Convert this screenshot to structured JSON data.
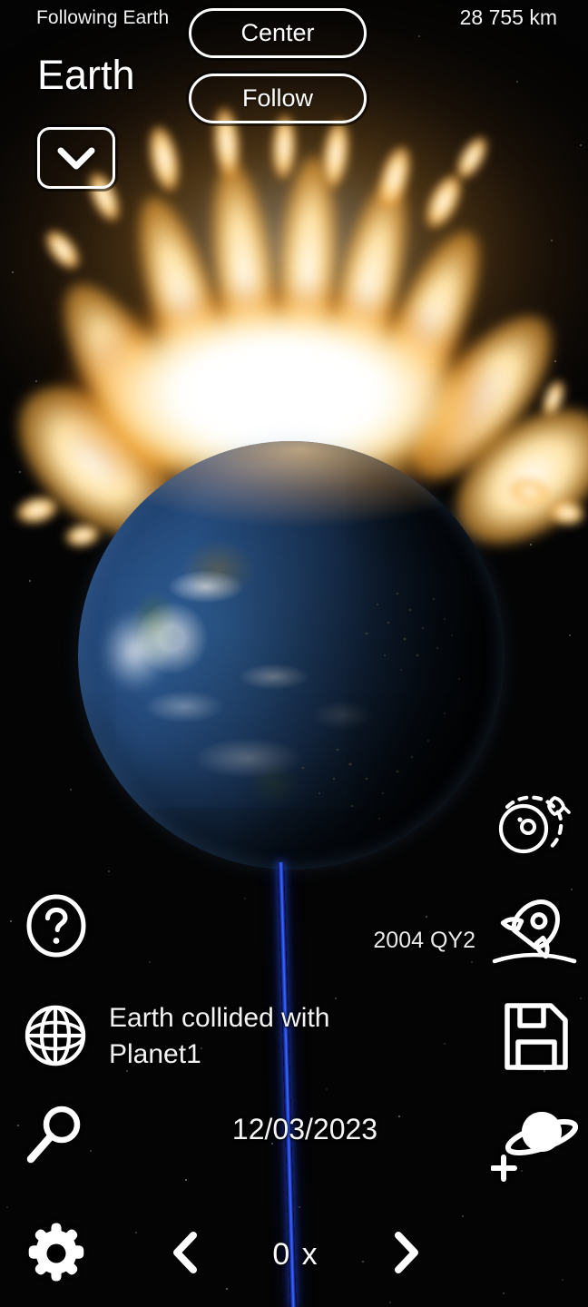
{
  "hud": {
    "following_label": "Following Earth",
    "distance": "28 755 km",
    "body_name": "Earth",
    "center_label": "Center",
    "follow_label": "Follow",
    "collapse_icon": "chevron-down-icon"
  },
  "sim": {
    "asteroid_label": "2004 QY2",
    "collision_message": "Earth collided with Planet1",
    "date": "12/03/2023",
    "speed_value": "0 x",
    "prev_speed_icon": "chevron-left-icon",
    "next_speed_icon": "chevron-right-icon"
  },
  "left_toolbar": [
    {
      "name": "help-button",
      "icon": "question-circle-icon"
    },
    {
      "name": "globe-button",
      "icon": "globe-icon"
    },
    {
      "name": "search-button",
      "icon": "search-icon"
    },
    {
      "name": "settings-button",
      "icon": "gear-icon"
    }
  ],
  "right_toolbar": [
    {
      "name": "orbit-button",
      "icon": "orbit-icon"
    },
    {
      "name": "launch-button",
      "icon": "rocket-launch-icon"
    },
    {
      "name": "save-button",
      "icon": "floppy-save-icon"
    },
    {
      "name": "add-planet-button",
      "icon": "saturn-plus-icon"
    }
  ],
  "colors": {
    "hud_text": "#ffffff",
    "orbit_line": "#2b55f8",
    "explosion_core": "#ffffff",
    "explosion_glow": "#ffb23a",
    "earth_ocean": "#2f5f96",
    "background": "#040404"
  }
}
